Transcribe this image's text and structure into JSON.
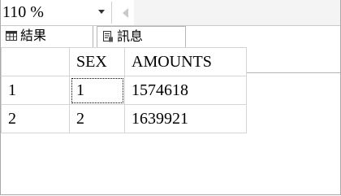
{
  "toolbar": {
    "zoom_value": "110 %",
    "dropdown_icon": "chevron-down-icon",
    "scroll_left_icon": "scroll-left-arrow-icon"
  },
  "tabs": [
    {
      "label": "結果",
      "icon": "grid-results-icon"
    },
    {
      "label": "訊息",
      "icon": "messages-icon"
    }
  ],
  "grid": {
    "columns": [
      "",
      "SEX",
      "AMOUNTS"
    ],
    "rows": [
      {
        "rownum": "1",
        "sex": "1",
        "amounts": "1574618"
      },
      {
        "rownum": "2",
        "sex": "2",
        "amounts": "1639921"
      }
    ]
  }
}
